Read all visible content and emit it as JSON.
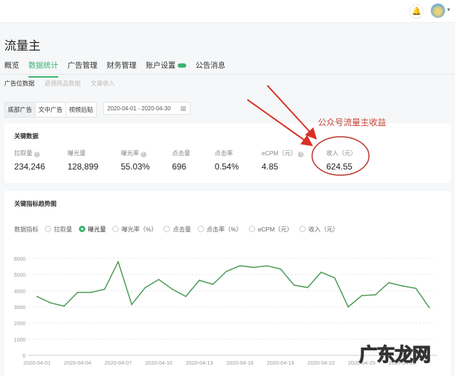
{
  "header": {
    "bell_icon": "bell-icon",
    "avatar": "avatar"
  },
  "page_title": "流量主",
  "tabs": [
    {
      "label": "概览"
    },
    {
      "label": "数据统计",
      "active": true
    },
    {
      "label": "广告管理"
    },
    {
      "label": "财务管理"
    },
    {
      "label": "账户设置",
      "badge": "new"
    },
    {
      "label": "公告消息"
    }
  ],
  "subtabs": [
    {
      "label": "广告位数据"
    },
    {
      "label": "返佣商品数据"
    },
    {
      "label": "文章收入"
    }
  ],
  "ad_types": [
    "底部广告",
    "文中广告",
    "视频后贴"
  ],
  "date_range": "2020-04-01 - 2020-04-30",
  "key_data": {
    "title": "关键数据",
    "metrics": [
      {
        "label": "拉取量",
        "value": "234,246",
        "help": true
      },
      {
        "label": "曝光量",
        "value": "128,899"
      },
      {
        "label": "曝光率",
        "value": "55.03%",
        "help": true
      },
      {
        "label": "点击量",
        "value": "696"
      },
      {
        "label": "点击率",
        "value": "0.54%"
      },
      {
        "label": "eCPM（元）",
        "value": "4.85",
        "help": true
      },
      {
        "label": "收入（元）",
        "value": "624.55"
      }
    ]
  },
  "annotation": "公众号流量主收益",
  "trend": {
    "title": "关键指标趋势图",
    "indicator_label": "数据指标",
    "options": [
      "拉取量",
      "曝光量",
      "曝光率（%）",
      "点击量",
      "点击率（%）",
      "eCPM（元）",
      "收入（元）"
    ],
    "selected": "曝光量"
  },
  "watermark": "广东龙网",
  "colors": {
    "accent": "#3cb371",
    "line": "#4a9a55",
    "annotation": "#c8443a"
  },
  "chart_data": {
    "type": "line",
    "title": "关键指标趋势图",
    "series": [
      {
        "name": "曝光量",
        "values": [
          3650,
          3250,
          3050,
          3900,
          3900,
          4100,
          5800,
          3150,
          4200,
          4700,
          4100,
          3650,
          4650,
          4400,
          5200,
          5550,
          5450,
          5550,
          5350,
          4350,
          4200,
          5150,
          4800,
          3000,
          3700,
          3750,
          4500,
          4300,
          4150,
          2950
        ]
      }
    ],
    "x": [
      "2020-04-01",
      "2020-04-02",
      "2020-04-03",
      "2020-04-04",
      "2020-04-05",
      "2020-04-06",
      "2020-04-07",
      "2020-04-08",
      "2020-04-09",
      "2020-04-10",
      "2020-04-11",
      "2020-04-12",
      "2020-04-13",
      "2020-04-14",
      "2020-04-15",
      "2020-04-16",
      "2020-04-17",
      "2020-04-18",
      "2020-04-19",
      "2020-04-20",
      "2020-04-21",
      "2020-04-22",
      "2020-04-23",
      "2020-04-24",
      "2020-04-25",
      "2020-04-26",
      "2020-04-27",
      "2020-04-28",
      "2020-04-29",
      "2020-04-30"
    ],
    "xticks": [
      "2020-04-01",
      "2020-04-04",
      "2020-04-07",
      "2020-04-10",
      "2020-04-13",
      "2020-04-16",
      "2020-04-19",
      "2020-04-22",
      "2020-04-25",
      "2020-04-28"
    ],
    "yticks": [
      0,
      1000,
      2000,
      3000,
      4000,
      5000,
      6000
    ],
    "ylim": [
      0,
      6000
    ],
    "grid": true
  }
}
